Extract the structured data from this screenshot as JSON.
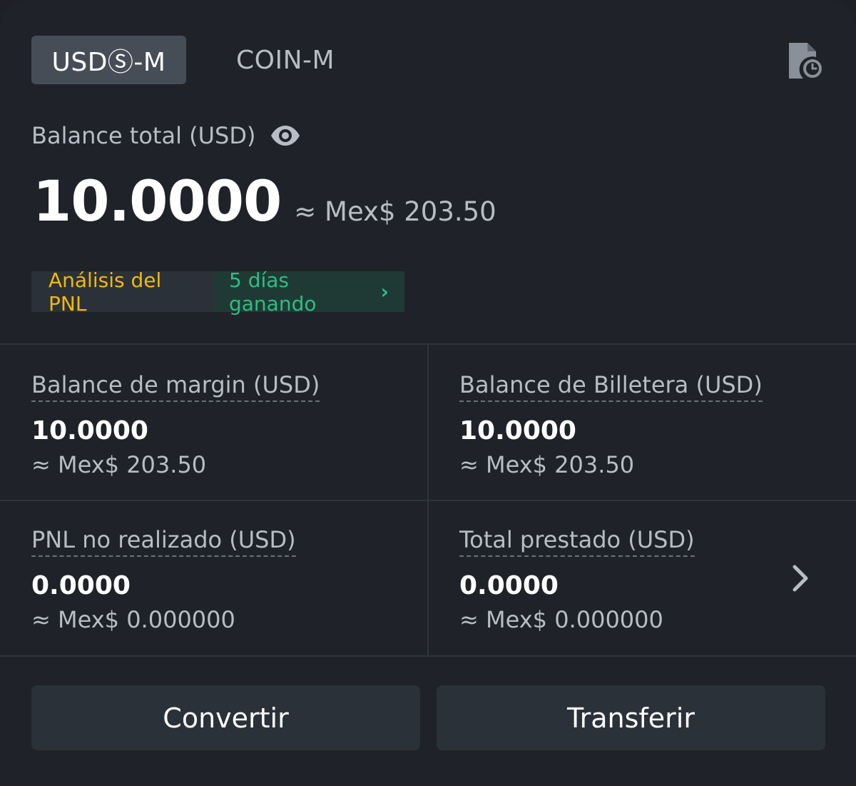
{
  "tabs": {
    "usds_m": "USDⓈ-M",
    "coin_m": "COIN-M"
  },
  "balance": {
    "label": "Balance total (USD)",
    "value": "10.0000",
    "approx": "≈ Mex$ 203.50"
  },
  "pnl": {
    "analysis_label": "Análisis del PNL",
    "streak_label": "5 días ganando"
  },
  "cards": {
    "margin": {
      "label": "Balance de margin (USD)",
      "value": "10.0000",
      "approx": "≈ Mex$ 203.50"
    },
    "wallet": {
      "label": "Balance de Billetera (USD)",
      "value": "10.0000",
      "approx": "≈ Mex$ 203.50"
    },
    "unrealized": {
      "label": "PNL no realizado (USD)",
      "value": "0.0000",
      "approx": "≈ Mex$ 0.000000"
    },
    "borrowed": {
      "label": "Total prestado (USD)",
      "value": "0.0000",
      "approx": "≈ Mex$ 0.000000"
    }
  },
  "actions": {
    "convert": "Convertir",
    "transfer": "Transferir"
  },
  "icons": {
    "history": "history-icon",
    "eye": "eye-icon",
    "chevron": "chevron-right-icon"
  },
  "colors": {
    "background": "#1f2228",
    "accent_yellow": "#f0b90b",
    "profit_green": "#2ebd85",
    "tab_active_bg": "#474d57"
  }
}
